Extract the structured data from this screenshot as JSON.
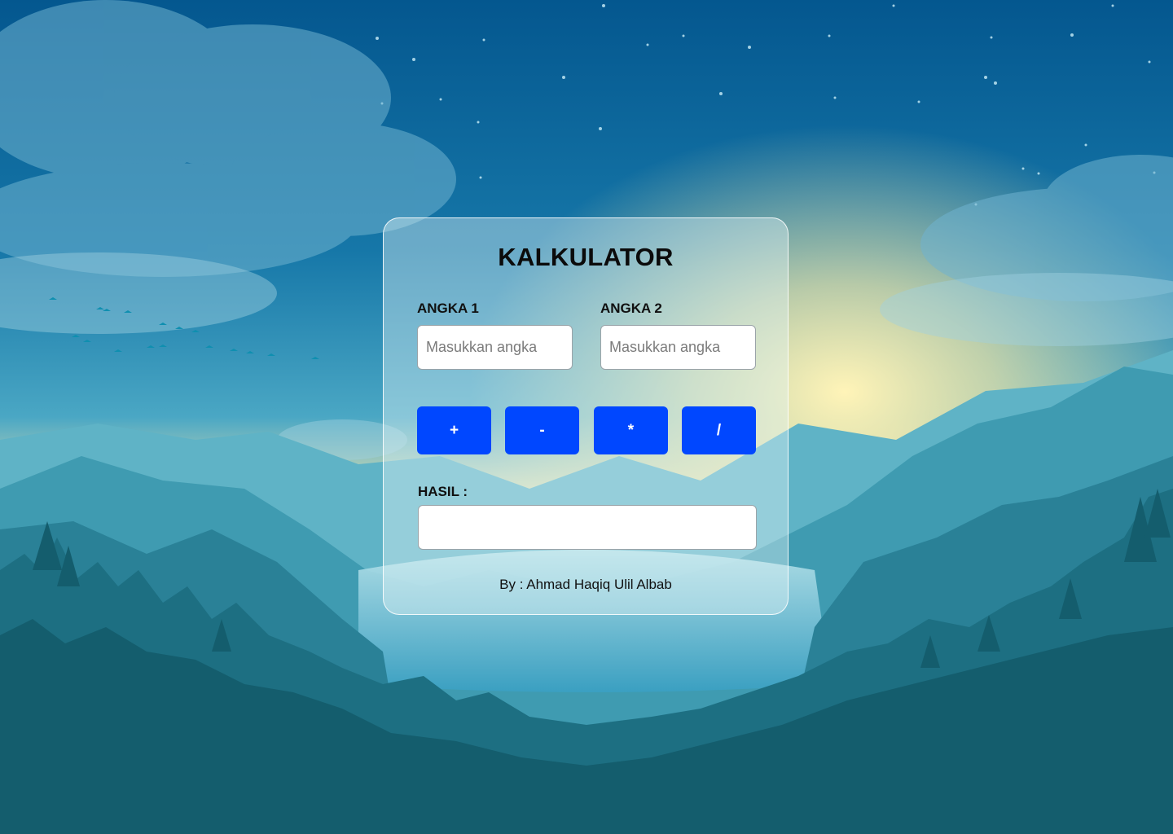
{
  "app": {
    "title": "KALKULATOR",
    "input1": {
      "label": "ANGKA 1",
      "placeholder": "Masukkan angka",
      "value": ""
    },
    "input2": {
      "label": "ANGKA 2",
      "placeholder": "Masukkan angka",
      "value": ""
    },
    "operators": [
      "+",
      "-",
      "*",
      "/"
    ],
    "result": {
      "label": "HASIL :",
      "value": ""
    },
    "credit": "By : Ahmad Haqiq Ulil Albab"
  },
  "colors": {
    "accent": "#0047ff",
    "sky_top": "#05578f",
    "sky_mid": "#2a93b8",
    "horizon_glow": "#f6e9a8",
    "forest": "#11596a"
  },
  "background": "mountain-lake-sunrise-scene"
}
